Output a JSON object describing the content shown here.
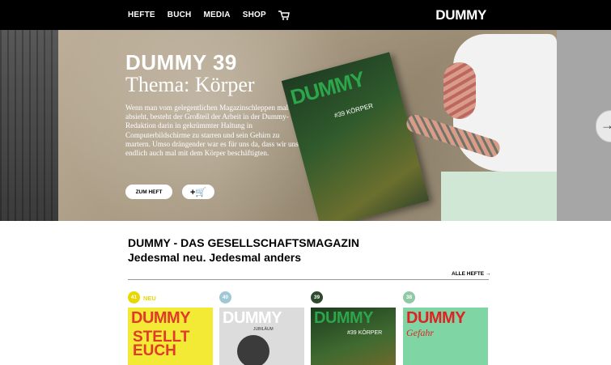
{
  "nav": {
    "items": [
      "HEFTE",
      "BUCH",
      "MEDIA",
      "SHOP"
    ],
    "cart_icon": "cart-icon",
    "brand": "DUMMY"
  },
  "hero": {
    "title": "DUMMY 39",
    "subtitle": "Thema: Körper",
    "body": "Wenn man vom gelegentlichen Magazinschleppen mal absieht, besteht der Großteil der Arbeit in der Dummy-Redaktion darin in gekrümmter Haltung in Computerbildschirme zu starren und sein Gehirn zu martern. Umso drängender war es für uns da, dass wir uns endlich auch mal mit dem Körper beschäftigten.",
    "button_label": "ZUM HEFT",
    "cart_button_label": "+🛒",
    "magazine_title": "DUMMY",
    "magazine_sub": "#39 KÖRPER",
    "next_icon": "arrow-right-icon"
  },
  "section": {
    "headline": "DUMMY - DAS GESELLSCHAFTSMAGAZIN",
    "subheadline": "Jedesmal neu. Jedesmal anders",
    "all_link": "ALLE HEFTE →"
  },
  "issues": [
    {
      "number": "41",
      "badge_color": "#e8d800",
      "label": "NEU",
      "cover_title": "DUMMY",
      "cover_text": "STELLT EUCH"
    },
    {
      "number": "40",
      "badge_color": "#9fc8d6",
      "cover_title": "DUMMY",
      "cover_text": "JUBILÄUM"
    },
    {
      "number": "39",
      "badge_color": "#2e4a2e",
      "cover_title": "DUMMY",
      "cover_text": "#39 KÖRPER"
    },
    {
      "number": "38",
      "badge_color": "#8fc9a6",
      "cover_title": "DUMMY",
      "cover_text": "Gefahr"
    }
  ]
}
